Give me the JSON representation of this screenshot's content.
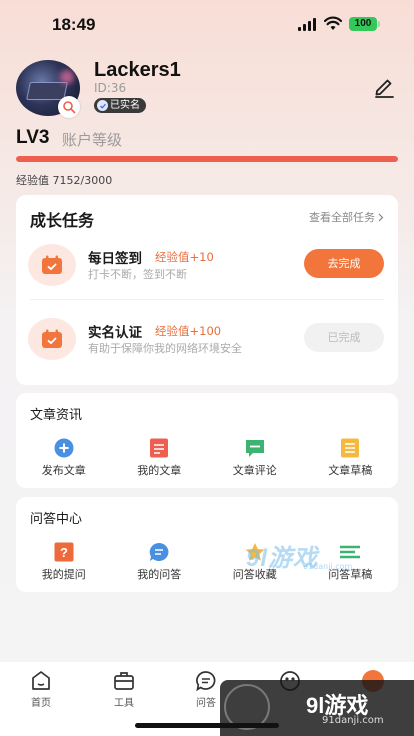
{
  "status_bar": {
    "time": "18:49",
    "battery": "100"
  },
  "profile": {
    "username": "Lackers1",
    "user_id": "ID:36",
    "verified_label": "已实名",
    "level": "LV3",
    "level_label": "账户等级",
    "exp_text": "经验值 7152/3000",
    "progress_fraction": 1.0
  },
  "growth": {
    "title": "成长任务",
    "view_all": "查看全部任务",
    "tasks": [
      {
        "name": "每日签到",
        "exp": "经验值+10",
        "desc": "打卡不断，签到不断",
        "button": "去完成"
      },
      {
        "name": "实名认证",
        "exp": "经验值+100",
        "desc": "有助于保障你我的网络环境安全",
        "button": "已完成"
      }
    ]
  },
  "articles": {
    "title": "文章资讯",
    "items": [
      {
        "label": "发布文章",
        "icon": "plus-icon",
        "color": "#4a90e2"
      },
      {
        "label": "我的文章",
        "icon": "article-icon",
        "color": "#ee5f4f"
      },
      {
        "label": "文章评论",
        "icon": "comment-icon",
        "color": "#3cb371"
      },
      {
        "label": "文章草稿",
        "icon": "draft-icon",
        "color": "#f5b942"
      }
    ]
  },
  "qa": {
    "title": "问答中心",
    "items": [
      {
        "label": "我的提问",
        "icon": "question-icon",
        "color": "#ee6a3a"
      },
      {
        "label": "我的问答",
        "icon": "chat-icon",
        "color": "#4a90e2"
      },
      {
        "label": "问答收藏",
        "icon": "star-icon",
        "color": "#f5b942"
      },
      {
        "label": "问答草稿",
        "icon": "draft-icon",
        "color": "#3cb371"
      }
    ]
  },
  "tabbar": {
    "tabs": [
      {
        "label": "首页",
        "icon": "home-icon"
      },
      {
        "label": "工具",
        "icon": "toolbox-icon"
      },
      {
        "label": "问答",
        "icon": "chat-icon"
      },
      {
        "label": "",
        "icon": "compass-icon"
      },
      {
        "label": "",
        "icon": "avatar-icon"
      }
    ]
  },
  "watermarks": {
    "mid_brand": "9l游戏",
    "mid_url": "91danji.com",
    "corner_brand": "9l游戏",
    "corner_url": "91danji.com"
  },
  "colors": {
    "accent": "#f2763c",
    "progress": "#ee5f4f",
    "exp_text": "#e86e3a"
  }
}
